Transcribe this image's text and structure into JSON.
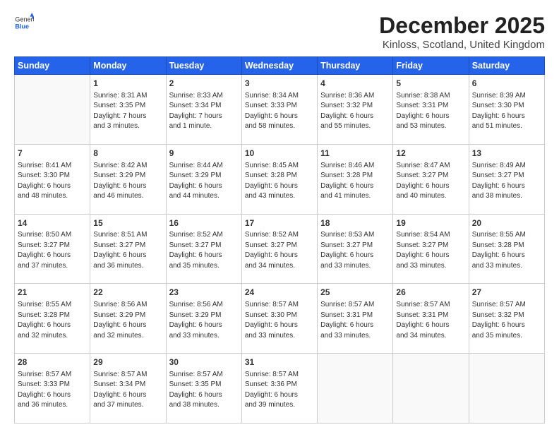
{
  "logo": {
    "general": "General",
    "blue": "Blue"
  },
  "title": "December 2025",
  "subtitle": "Kinloss, Scotland, United Kingdom",
  "days_header": [
    "Sunday",
    "Monday",
    "Tuesday",
    "Wednesday",
    "Thursday",
    "Friday",
    "Saturday"
  ],
  "weeks": [
    [
      {
        "day": "",
        "info": ""
      },
      {
        "day": "1",
        "info": "Sunrise: 8:31 AM\nSunset: 3:35 PM\nDaylight: 7 hours\nand 3 minutes."
      },
      {
        "day": "2",
        "info": "Sunrise: 8:33 AM\nSunset: 3:34 PM\nDaylight: 7 hours\nand 1 minute."
      },
      {
        "day": "3",
        "info": "Sunrise: 8:34 AM\nSunset: 3:33 PM\nDaylight: 6 hours\nand 58 minutes."
      },
      {
        "day": "4",
        "info": "Sunrise: 8:36 AM\nSunset: 3:32 PM\nDaylight: 6 hours\nand 55 minutes."
      },
      {
        "day": "5",
        "info": "Sunrise: 8:38 AM\nSunset: 3:31 PM\nDaylight: 6 hours\nand 53 minutes."
      },
      {
        "day": "6",
        "info": "Sunrise: 8:39 AM\nSunset: 3:30 PM\nDaylight: 6 hours\nand 51 minutes."
      }
    ],
    [
      {
        "day": "7",
        "info": "Sunrise: 8:41 AM\nSunset: 3:30 PM\nDaylight: 6 hours\nand 48 minutes."
      },
      {
        "day": "8",
        "info": "Sunrise: 8:42 AM\nSunset: 3:29 PM\nDaylight: 6 hours\nand 46 minutes."
      },
      {
        "day": "9",
        "info": "Sunrise: 8:44 AM\nSunset: 3:29 PM\nDaylight: 6 hours\nand 44 minutes."
      },
      {
        "day": "10",
        "info": "Sunrise: 8:45 AM\nSunset: 3:28 PM\nDaylight: 6 hours\nand 43 minutes."
      },
      {
        "day": "11",
        "info": "Sunrise: 8:46 AM\nSunset: 3:28 PM\nDaylight: 6 hours\nand 41 minutes."
      },
      {
        "day": "12",
        "info": "Sunrise: 8:47 AM\nSunset: 3:27 PM\nDaylight: 6 hours\nand 40 minutes."
      },
      {
        "day": "13",
        "info": "Sunrise: 8:49 AM\nSunset: 3:27 PM\nDaylight: 6 hours\nand 38 minutes."
      }
    ],
    [
      {
        "day": "14",
        "info": "Sunrise: 8:50 AM\nSunset: 3:27 PM\nDaylight: 6 hours\nand 37 minutes."
      },
      {
        "day": "15",
        "info": "Sunrise: 8:51 AM\nSunset: 3:27 PM\nDaylight: 6 hours\nand 36 minutes."
      },
      {
        "day": "16",
        "info": "Sunrise: 8:52 AM\nSunset: 3:27 PM\nDaylight: 6 hours\nand 35 minutes."
      },
      {
        "day": "17",
        "info": "Sunrise: 8:52 AM\nSunset: 3:27 PM\nDaylight: 6 hours\nand 34 minutes."
      },
      {
        "day": "18",
        "info": "Sunrise: 8:53 AM\nSunset: 3:27 PM\nDaylight: 6 hours\nand 33 minutes."
      },
      {
        "day": "19",
        "info": "Sunrise: 8:54 AM\nSunset: 3:27 PM\nDaylight: 6 hours\nand 33 minutes."
      },
      {
        "day": "20",
        "info": "Sunrise: 8:55 AM\nSunset: 3:28 PM\nDaylight: 6 hours\nand 33 minutes."
      }
    ],
    [
      {
        "day": "21",
        "info": "Sunrise: 8:55 AM\nSunset: 3:28 PM\nDaylight: 6 hours\nand 32 minutes."
      },
      {
        "day": "22",
        "info": "Sunrise: 8:56 AM\nSunset: 3:29 PM\nDaylight: 6 hours\nand 32 minutes."
      },
      {
        "day": "23",
        "info": "Sunrise: 8:56 AM\nSunset: 3:29 PM\nDaylight: 6 hours\nand 33 minutes."
      },
      {
        "day": "24",
        "info": "Sunrise: 8:57 AM\nSunset: 3:30 PM\nDaylight: 6 hours\nand 33 minutes."
      },
      {
        "day": "25",
        "info": "Sunrise: 8:57 AM\nSunset: 3:31 PM\nDaylight: 6 hours\nand 33 minutes."
      },
      {
        "day": "26",
        "info": "Sunrise: 8:57 AM\nSunset: 3:31 PM\nDaylight: 6 hours\nand 34 minutes."
      },
      {
        "day": "27",
        "info": "Sunrise: 8:57 AM\nSunset: 3:32 PM\nDaylight: 6 hours\nand 35 minutes."
      }
    ],
    [
      {
        "day": "28",
        "info": "Sunrise: 8:57 AM\nSunset: 3:33 PM\nDaylight: 6 hours\nand 36 minutes."
      },
      {
        "day": "29",
        "info": "Sunrise: 8:57 AM\nSunset: 3:34 PM\nDaylight: 6 hours\nand 37 minutes."
      },
      {
        "day": "30",
        "info": "Sunrise: 8:57 AM\nSunset: 3:35 PM\nDaylight: 6 hours\nand 38 minutes."
      },
      {
        "day": "31",
        "info": "Sunrise: 8:57 AM\nSunset: 3:36 PM\nDaylight: 6 hours\nand 39 minutes."
      },
      {
        "day": "",
        "info": ""
      },
      {
        "day": "",
        "info": ""
      },
      {
        "day": "",
        "info": ""
      }
    ]
  ]
}
